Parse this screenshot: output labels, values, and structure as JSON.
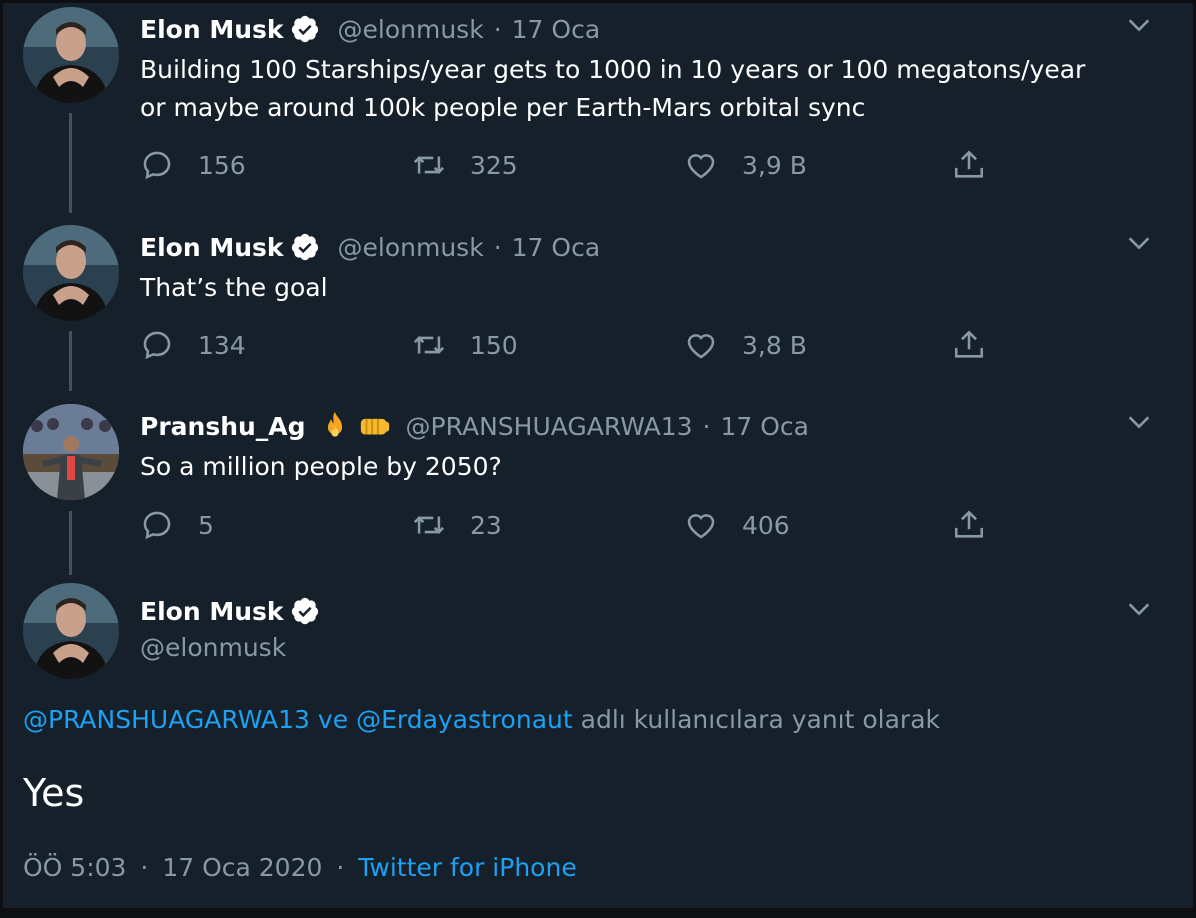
{
  "tweets": [
    {
      "name": "Elon Musk",
      "handle": "@elonmusk",
      "separator": "·",
      "date": "17 Oca",
      "text_line1": "Building 100 Starships/year gets to 1000 in 10 years or 100 megatons/year",
      "text_line2": "or maybe around 100k people per Earth-Mars orbital sync",
      "replies": "156",
      "retweets": "325",
      "likes": "3,9 B"
    },
    {
      "name": "Elon Musk",
      "handle": "@elonmusk",
      "separator": "·",
      "date": "17 Oca",
      "text_line1": "That’s the goal",
      "replies": "134",
      "retweets": "150",
      "likes": "3,8 B"
    },
    {
      "name": "Pranshu_Ag",
      "emoji_1": "fire-emoji",
      "emoji_2": "fist-emoji",
      "handle": "@PRANSHUAGARWA13",
      "separator": "·",
      "date": "17 Oca",
      "text_line1": "So a million people by 2050?",
      "replies": "5",
      "retweets": "23",
      "likes": "406"
    }
  ],
  "main": {
    "name": "Elon Musk",
    "handle": "@elonmusk",
    "reply_to_mention_1": "@PRANSHUAGARWA13",
    "reply_to_and": "ve",
    "reply_to_mention_2": "@Erdayastronaut",
    "reply_to_suffix": "adlı kullanıcılara yanıt olarak",
    "text": "Yes",
    "time": "ÖÖ 5:03",
    "separator": "·",
    "date": "17 Oca 2020",
    "separator2": "·",
    "source": "Twitter for iPhone"
  },
  "colors": {
    "background": "#15202b",
    "link": "#1da1f2",
    "secondary_text": "#8899a6"
  }
}
